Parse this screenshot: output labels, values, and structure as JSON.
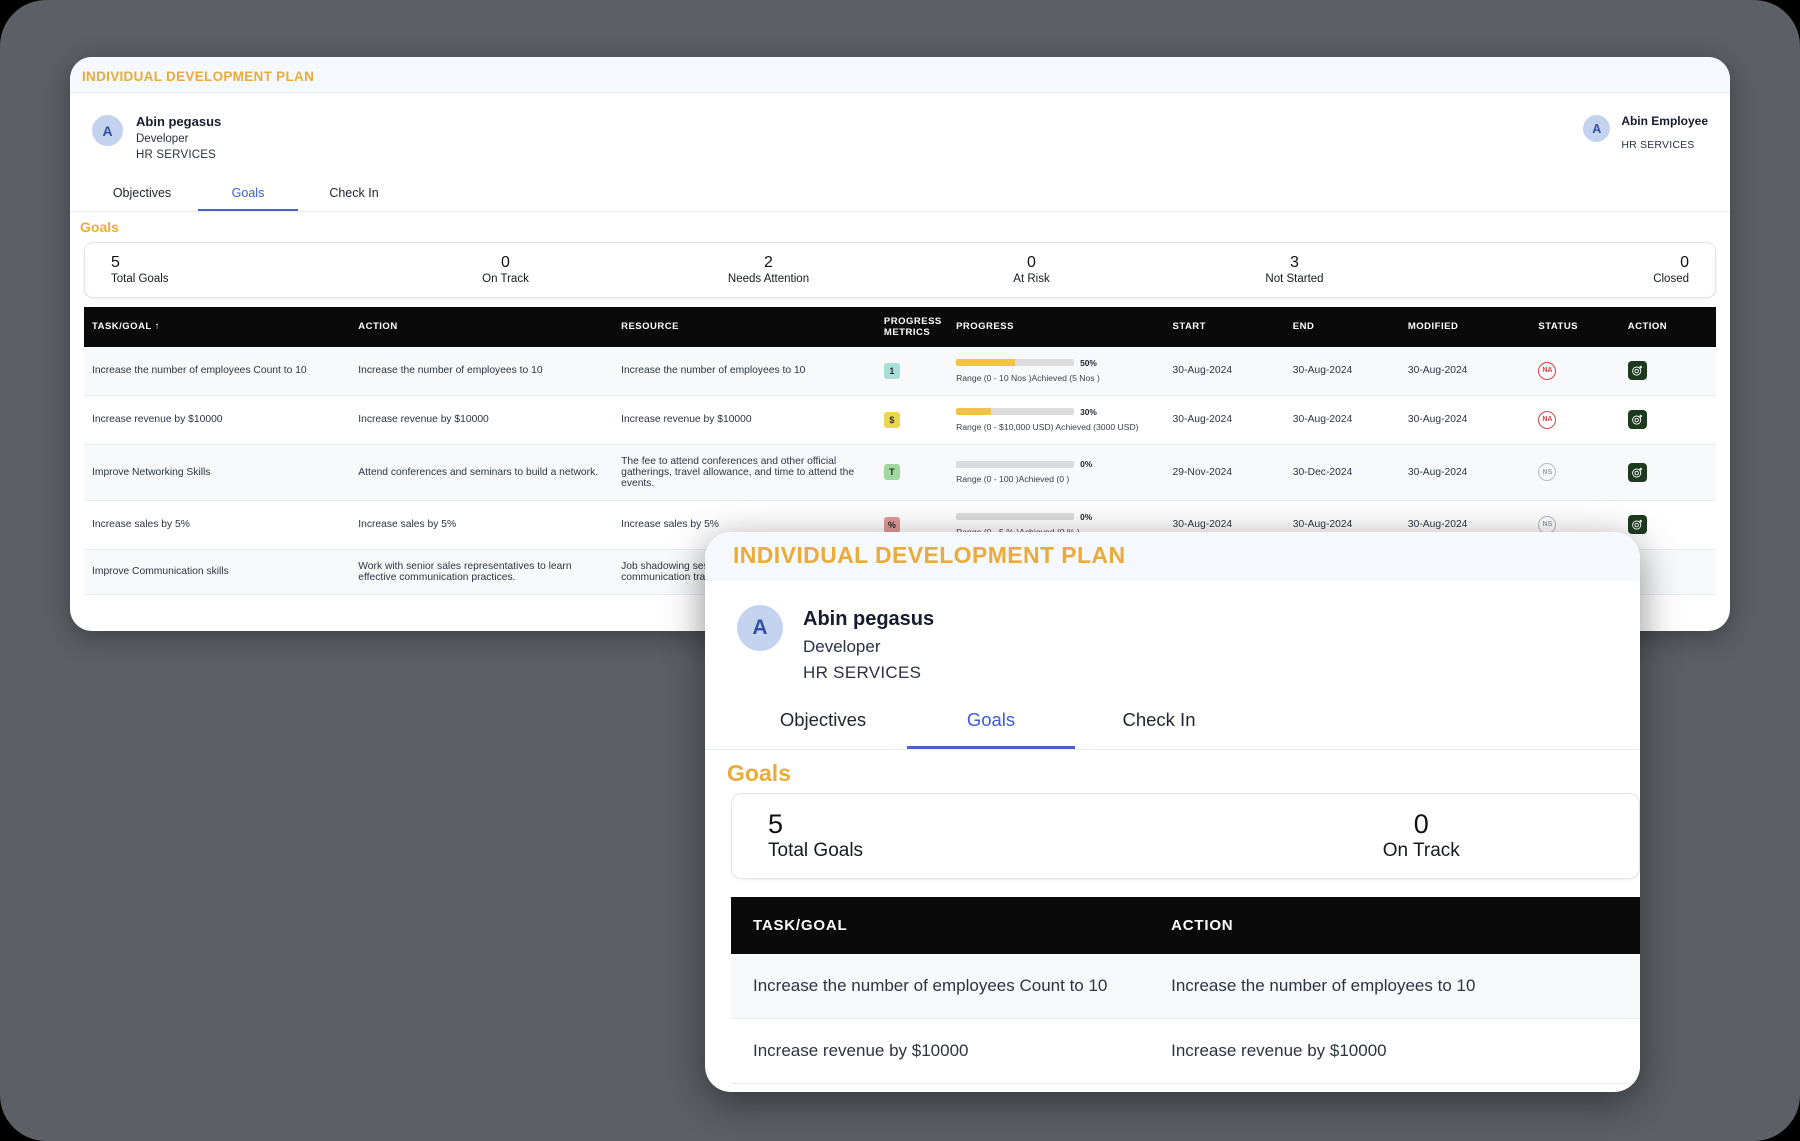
{
  "app": {
    "title": "INDIVIDUAL DEVELOPMENT PLAN"
  },
  "user": {
    "initial": "A",
    "name": "Abin pegasus",
    "role": "Developer",
    "dept": "HR SERVICES"
  },
  "user_right": {
    "initial": "A",
    "name": "Abin Employee",
    "dept": "HR SERVICES"
  },
  "tabs": [
    {
      "label": "Objectives",
      "active": false
    },
    {
      "label": "Goals",
      "active": true
    },
    {
      "label": "Check In",
      "active": false
    }
  ],
  "section": {
    "title": "Goals"
  },
  "stats": [
    {
      "num": "5",
      "label": "Total Goals",
      "color": "#111111"
    },
    {
      "num": "0",
      "label": "On Track",
      "color": "#4a63c9"
    },
    {
      "num": "2",
      "label": "Needs Attention",
      "color": "#eaab3a"
    },
    {
      "num": "0",
      "label": "At Risk",
      "color": "#e05a5a"
    },
    {
      "num": "3",
      "label": "Not Started",
      "color": "#a9b0ba"
    },
    {
      "num": "0",
      "label": "Closed",
      "color": "#4caf50"
    }
  ],
  "table": {
    "columns": [
      "TASK/GOAL ↑",
      "ACTION",
      "RESOURCE",
      "PROGRESS METRICS",
      "PROGRESS",
      "START",
      "END",
      "MODIFIED",
      "STATUS",
      "ACTION"
    ],
    "col_task": "TASK/GOAL ↑",
    "col_action": "ACTION",
    "col_resource": "RESOURCE",
    "col_metrics_l1": "PROGRESS",
    "col_metrics_l2": "METRICS",
    "col_progress": "PROGRESS",
    "col_start": "START",
    "col_end": "END",
    "col_modified": "MODIFIED",
    "col_status": "STATUS",
    "col_action2": "ACTION",
    "rows": [
      {
        "task": "Increase the number of employees Count to 10",
        "action": "Increase the number of employees to 10",
        "resource": "Increase the number of employees to 10",
        "metric_badge": "1",
        "metric_type": "count",
        "percent": "50%",
        "percent_value": 50,
        "range": "Range (0 - 10 Nos )Achieved (5 Nos )",
        "start": "30-Aug-2024",
        "end": "30-Aug-2024",
        "modified": "30-Aug-2024",
        "status": "NA",
        "status_type": "na",
        "action_icon": "target-plus-icon"
      },
      {
        "task": "Increase revenue by $10000",
        "action": "Increase revenue by $10000",
        "resource": "Increase revenue by $10000",
        "metric_badge": "$",
        "metric_type": "money",
        "percent": "30%",
        "percent_value": 30,
        "range": "Range (0 - $10,000 USD) Achieved (3000 USD)",
        "start": "30-Aug-2024",
        "end": "30-Aug-2024",
        "modified": "30-Aug-2024",
        "status": "NA",
        "status_type": "na",
        "action_icon": "target-plus-icon"
      },
      {
        "task": "Improve Networking Skills",
        "action": "Attend conferences and seminars to build a network.",
        "resource": "The fee to attend conferences and other official gatherings, travel allowance, and time to attend the events.",
        "metric_badge": "T",
        "metric_type": "text",
        "percent": "0%",
        "percent_value": 0,
        "range": "Range (0 - 100 )Achieved (0 )",
        "start": "29-Nov-2024",
        "end": "30-Dec-2024",
        "modified": "30-Aug-2024",
        "status": "NS",
        "status_type": "ns",
        "action_icon": "target-plus-icon"
      },
      {
        "task": "Increase sales by 5%",
        "action": "Increase sales by 5%",
        "resource": "Increase sales by 5%",
        "metric_badge": "%",
        "metric_type": "percent",
        "percent": "0%",
        "percent_value": 0,
        "range": "Range (0 - 5 % )Achieved (0 % )",
        "start": "30-Aug-2024",
        "end": "30-Aug-2024",
        "modified": "30-Aug-2024",
        "status": "NS",
        "status_type": "ns",
        "action_icon": "target-plus-icon"
      },
      {
        "task": "Improve Communication skills",
        "action": "Work with senior sales representatives to learn effective communication practices.",
        "resource": "Job shadowing sessions and access to communication training materials to understand",
        "metric_badge": "",
        "metric_type": "",
        "percent": "",
        "percent_value": 0,
        "range": "",
        "start": "",
        "end": "",
        "modified": "",
        "status": "",
        "status_type": "",
        "action_icon": ""
      }
    ]
  },
  "inset": {
    "title": "INDIVIDUAL DEVELOPMENT PLAN",
    "user": {
      "initial": "A",
      "name": "Abin pegasus",
      "role": "Developer",
      "dept": "HR SERVICES"
    },
    "tabs": [
      {
        "label": "Objectives",
        "active": false
      },
      {
        "label": "Goals",
        "active": true
      },
      {
        "label": "Check In",
        "active": false
      }
    ],
    "section": {
      "title": "Goals"
    },
    "stats": [
      {
        "num": "5",
        "label": "Total Goals"
      },
      {
        "num": "0",
        "label": "On Track"
      }
    ],
    "table": {
      "col_task": "TASK/GOAL",
      "col_action": "ACTION",
      "rows": [
        {
          "task": "Increase the number of employees Count to 10",
          "action": "Increase the number of employees to 10"
        },
        {
          "task": "Increase revenue by $10000",
          "action": "Increase revenue by $10000"
        }
      ]
    }
  },
  "colors": {
    "accent_amber": "#eaab3a",
    "accent_blue": "#4a63c9",
    "header_black": "#0a0a0a",
    "progress_fill": "#f3c346",
    "backdrop": "#5c6066"
  }
}
